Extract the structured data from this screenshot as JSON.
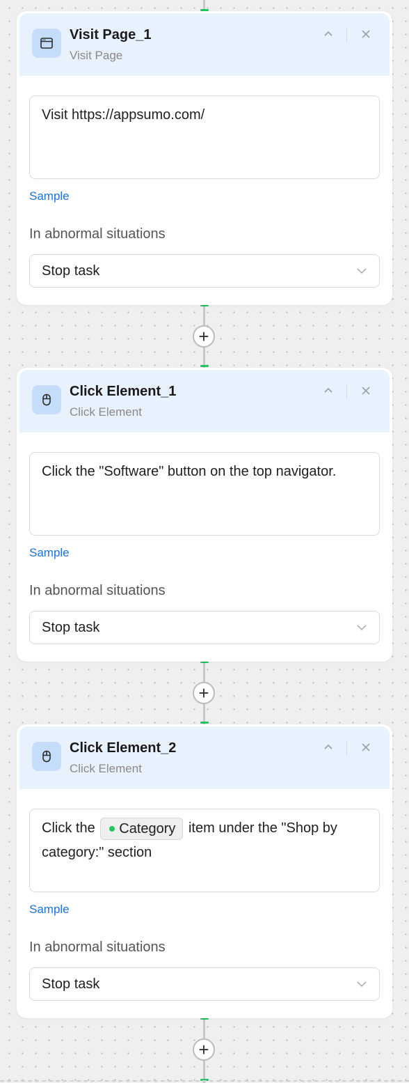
{
  "add_step_icon": "plus-icon",
  "colors": {
    "accent": "#22c55e",
    "header_bg": "#e8f1fe",
    "icon_bg": "#c5dcfb",
    "link": "#1a73e8"
  },
  "cards": [
    {
      "title": "Visit Page_1",
      "subtitle": "Visit Page",
      "icon": "browser-window-icon",
      "prompt": "Visit https://appsumo.com/",
      "sample_label": "Sample",
      "abnormal_label": "In abnormal situations",
      "abnormal_value": "Stop task"
    },
    {
      "title": "Click Element_1",
      "subtitle": "Click Element",
      "icon": "mouse-icon",
      "prompt": "Click the \"Software\" button on the top navigator.",
      "sample_label": "Sample",
      "abnormal_label": "In abnormal situations",
      "abnormal_value": "Stop task"
    },
    {
      "title": "Click Element_2",
      "subtitle": "Click Element",
      "icon": "mouse-icon",
      "prompt_before": "Click the",
      "prompt_chip": "Category",
      "prompt_after": "item under the \"Shop by category:\" section",
      "sample_label": "Sample",
      "abnormal_label": "In abnormal situations",
      "abnormal_value": "Stop task"
    }
  ]
}
